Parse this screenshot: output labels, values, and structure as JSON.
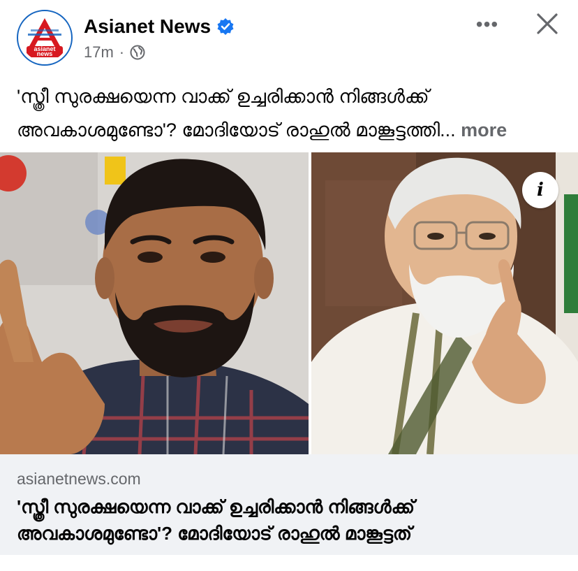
{
  "header": {
    "page_name": "Asianet News",
    "logo_text": "asianet news",
    "timestamp": "17m",
    "separator": "·",
    "more_label": "•••",
    "verified_color": "#1877f2"
  },
  "post": {
    "caption_line1": "'സ്ത്രീ സുരക്ഷയെന്ന വാക്ക് ഉച്ചരിക്കാൻ നിങ്ങൾക്ക്",
    "caption_line2": "അവകാശമുണ്ടോ'? മോദിയോട് രാഹുൽ മാങ്കൂട്ടത്തി...",
    "see_more": "more"
  },
  "media": {
    "info_label": "i"
  },
  "link_preview": {
    "domain": "asianetnews.com",
    "title_line1": "'സ്ത്രീ സുരക്ഷയെന്ന വാക്ക് ഉച്ചരിക്കാൻ നിങ്ങൾക്ക്",
    "title_line2": "അവകാശമുണ്ടോ'? മോദിയോട് രാഹുൽ മാങ്കൂട്ടത്"
  }
}
